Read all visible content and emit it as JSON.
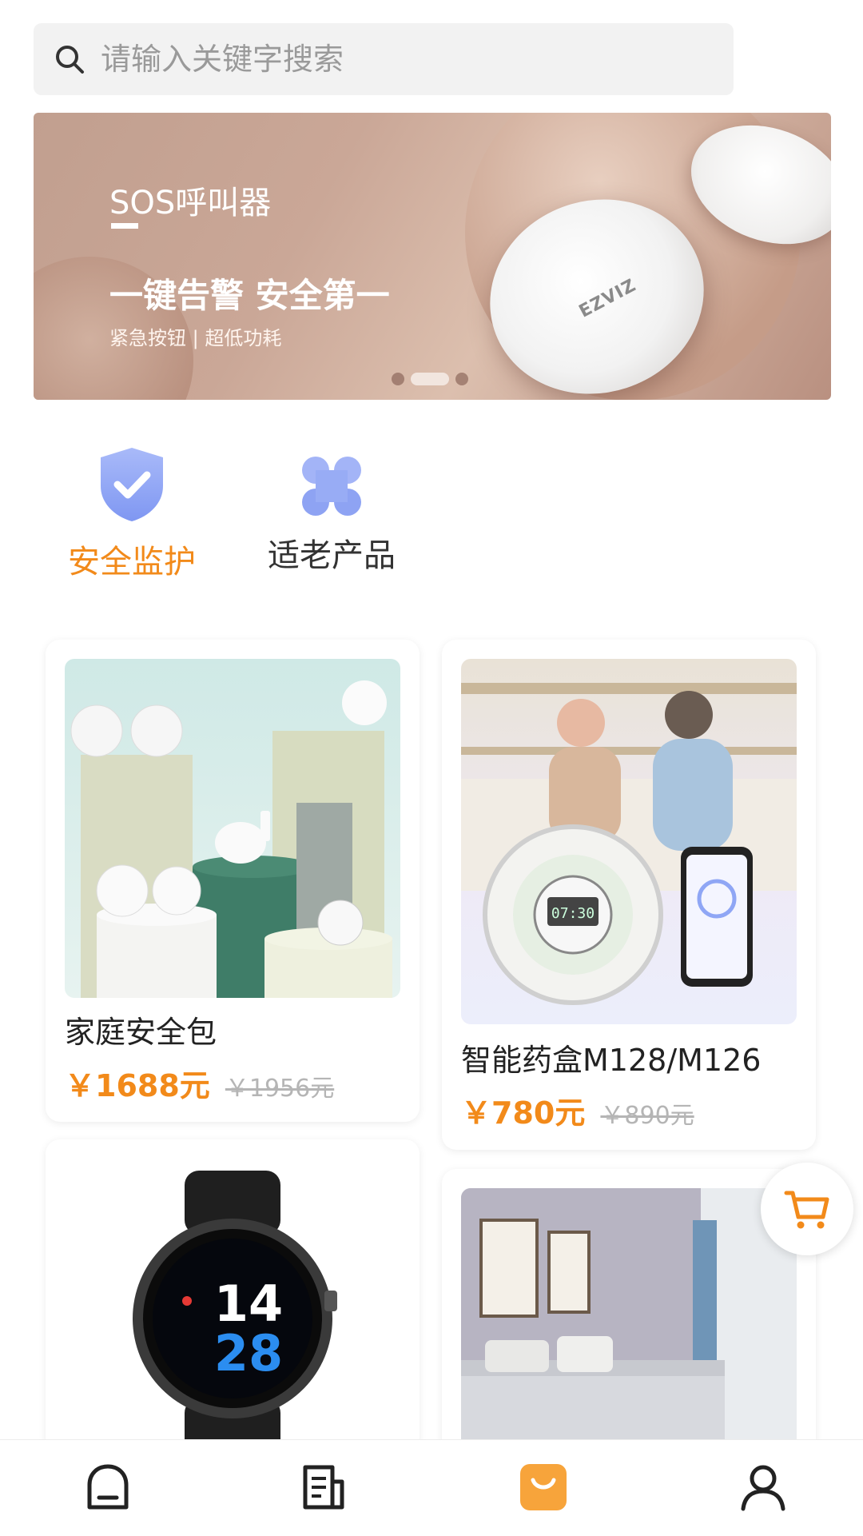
{
  "search": {
    "placeholder": "请输入关键字搜索",
    "icon": "search-icon"
  },
  "banner": {
    "title": "SOS呼叫器",
    "headline": "一键告警 安全第一",
    "subline": "紧急按钮 | 超低功耗",
    "brand": "EZVIZ",
    "pages": 3,
    "active_page": 2
  },
  "categories": [
    {
      "label": "安全监护",
      "icon": "shield-check-icon",
      "active": true
    },
    {
      "label": "适老产品",
      "icon": "clover-grid-icon",
      "active": false
    }
  ],
  "products": [
    {
      "name": "家庭安全包",
      "price": "￥1688元",
      "original_price": "￥1956元"
    },
    {
      "name": "智能药盒M128/M126",
      "price": "￥780元",
      "original_price": "￥890元"
    },
    {
      "name": "",
      "price": "",
      "original_price": ""
    },
    {
      "name": "",
      "price": "",
      "original_price": ""
    }
  ],
  "watch_display": {
    "hour": "14",
    "minute": "28"
  },
  "pillbox_display": "07:30",
  "cart": {
    "icon": "cart-icon"
  },
  "nav": [
    {
      "icon": "home-icon",
      "active": false
    },
    {
      "icon": "news-icon",
      "active": false
    },
    {
      "icon": "shop-bag-icon",
      "active": true
    },
    {
      "icon": "user-icon",
      "active": false
    }
  ],
  "colors": {
    "accent": "#f28a1a",
    "category_icon": "#8fa6f5",
    "text": "#222222",
    "muted": "#b5b5b5"
  }
}
